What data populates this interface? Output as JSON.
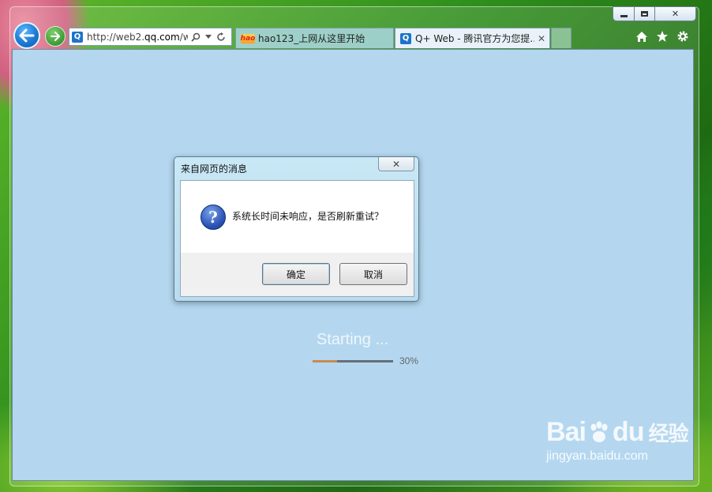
{
  "window": {
    "controls": {
      "minimize": "",
      "maximize": "",
      "close": "✕"
    }
  },
  "toolbar": {
    "address_prefix": "http://web2.",
    "address_domain": "qq.com",
    "address_suffix": "/w"
  },
  "tabs": [
    {
      "title": "hao123_上网从这里开始",
      "icon": "hao123-icon"
    },
    {
      "title": "Q+ Web - 腾讯官方为您提...",
      "icon": "qq-icon",
      "active": true
    }
  ],
  "page": {
    "status_text": "Starting ...",
    "progress": {
      "value": 0.3,
      "label": "30%"
    }
  },
  "dialog": {
    "title": "来自网页的消息",
    "message": "系统长时间未响应，是否刷新重试？",
    "ok_label": "确定",
    "cancel_label": "取消"
  },
  "watermark": {
    "brand": "Bai",
    "brand_tail": "du",
    "brand_cn": "经验",
    "url": "jingyan.baidu.com"
  },
  "colors": {
    "content_bg": "#b4d7ef",
    "progress_fill": "#c88b52",
    "progress_track": "#666f78",
    "back_button": "#1f7ed8"
  }
}
